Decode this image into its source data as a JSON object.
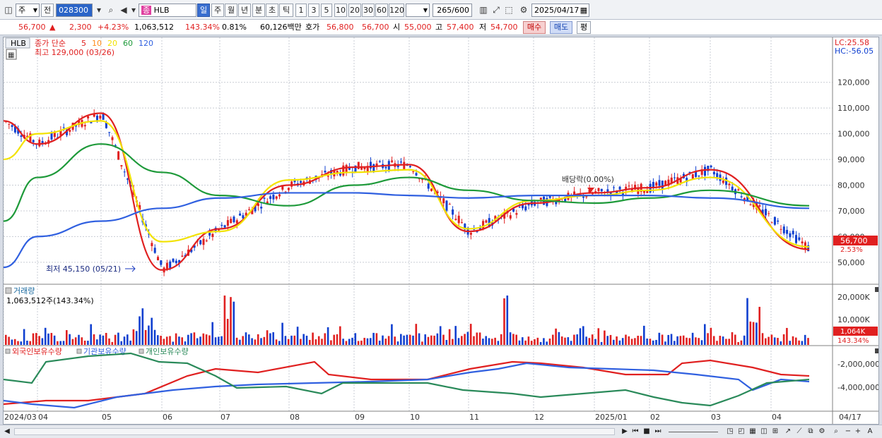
{
  "toolbar": {
    "market_type": "주",
    "prev_label": "전",
    "stock_code": "028300",
    "stock_name": "HLB",
    "name_prefix": "종",
    "periods": [
      "일",
      "주",
      "월",
      "년",
      "분",
      "초",
      "틱"
    ],
    "active_period": "일",
    "intervals": [
      "1",
      "3",
      "5",
      "10",
      "20",
      "30",
      "60",
      "120"
    ],
    "count_value": "265",
    "count_total": "/600",
    "date": "2025/04/17"
  },
  "quote": {
    "price": "56,700",
    "change_arrow": "▲",
    "change": "2,300",
    "change_pct": "+4.23%",
    "volume": "1,063,512",
    "volume_ratio": "143.34%",
    "turnover_pct": "0.81%",
    "amount": "60,126백만",
    "bid_label": "호가",
    "bid_price": "56,800",
    "ask_price": "56,700",
    "open_label": "시",
    "open": "55,000",
    "high_label": "고",
    "high": "57,400",
    "low_label": "저",
    "low": "54,700",
    "buy_label": "매수",
    "sell_label": "매도",
    "eval_label": "평"
  },
  "price_panel": {
    "name": "HLB",
    "legend_prefix": "종가 단순",
    "ma_periods": [
      "5",
      "10",
      "20",
      "60",
      "120"
    ],
    "ma_colors": [
      "#e02020",
      "#ff8c1a",
      "#f2e200",
      "#1e9a3a",
      "#3060e0"
    ],
    "high_note": "최고 129,000 (03/26)",
    "low_note": "최저 45,150 (05/21)",
    "dividend_note": "배당락(0.00%)",
    "lc": "LC:25.58",
    "hc": "HC:-56.05",
    "last_price_tag": "56,700",
    "last_pct_tag": "2.53%",
    "y_ticks": [
      "120,000",
      "110,000",
      "100,000",
      "90,000",
      "80,000",
      "70,000",
      "60,000",
      "50,000"
    ]
  },
  "volume_panel": {
    "title": "거래량",
    "info": "1,063,512주(143.34%)",
    "y_ticks": [
      "20,000K",
      "10,000K"
    ],
    "last_tag": "1,064K",
    "last_pct": "143.34%"
  },
  "holding_panel": {
    "series": [
      "외국인보유수량",
      "기관보유수량",
      "개인보유수량"
    ],
    "colors": [
      "#e02020",
      "#3060e0",
      "#2a8a5a"
    ],
    "y_ticks": [
      "-2,000,000",
      "-4,000,000"
    ]
  },
  "x_axis": {
    "labels": [
      "2024/03",
      "04",
      "05",
      "06",
      "07",
      "08",
      "09",
      "10",
      "11",
      "12",
      "2025/01",
      "02",
      "03",
      "04"
    ],
    "end_label": "04/17"
  },
  "chart_data": {
    "type": "line",
    "x": [
      "2024/03",
      "04",
      "05",
      "06",
      "07",
      "08",
      "09",
      "10",
      "11",
      "12",
      "2025/01",
      "02",
      "03",
      "04"
    ],
    "series": [
      {
        "name": "5",
        "values": [
          105000,
          96000,
          108000,
          47000,
          63000,
          80000,
          87000,
          88000,
          62000,
          73000,
          77000,
          79000,
          86000,
          55000
        ]
      },
      {
        "name": "20",
        "values": [
          90000,
          100000,
          105000,
          58000,
          62000,
          82000,
          85000,
          86000,
          63000,
          74000,
          76000,
          78000,
          83000,
          56000
        ]
      },
      {
        "name": "60",
        "values": [
          66000,
          83000,
          96000,
          85000,
          76000,
          72000,
          80000,
          83000,
          78000,
          74000,
          73000,
          75000,
          78000,
          72000
        ]
      },
      {
        "name": "120",
        "values": [
          48000,
          60000,
          66000,
          71000,
          75000,
          77000,
          77000,
          76000,
          75000,
          76000,
          76000,
          76000,
          75000,
          71000
        ]
      }
    ],
    "ylim": [
      42000,
      132000
    ]
  }
}
